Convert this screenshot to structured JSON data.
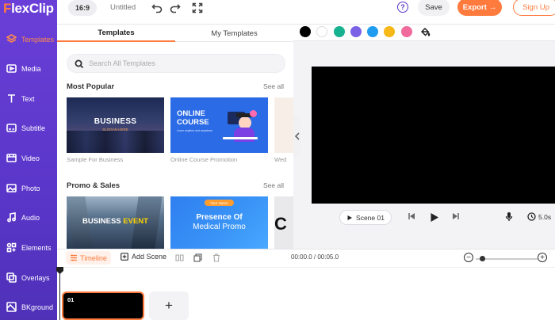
{
  "app": {
    "logo_prefix": "F",
    "logo_rest": "lexClip"
  },
  "topbar": {
    "ratio": "16:9",
    "title": "Untitled",
    "help": "?",
    "save": "Save",
    "export": "Export",
    "export_arrow": "→",
    "signup": "Sign Up"
  },
  "sidebar": {
    "items": [
      {
        "label": "Templates",
        "icon": "templates-icon",
        "active": true
      },
      {
        "label": "Media",
        "icon": "media-icon"
      },
      {
        "label": "Text",
        "icon": "text-icon"
      },
      {
        "label": "Subtitle",
        "icon": "subtitle-icon"
      },
      {
        "label": "Video",
        "icon": "video-icon"
      },
      {
        "label": "Photo",
        "icon": "photo-icon"
      },
      {
        "label": "Audio",
        "icon": "audio-icon"
      },
      {
        "label": "Elements",
        "icon": "elements-icon"
      },
      {
        "label": "Overlays",
        "icon": "overlays-icon"
      },
      {
        "label": "BKground",
        "icon": "background-icon"
      }
    ]
  },
  "panel": {
    "tabs": [
      "Templates",
      "My Templates"
    ],
    "search_placeholder": "Search All Templates",
    "sections": [
      {
        "title": "Most Popular",
        "see_all": "See all",
        "cards": [
          {
            "caption": "Sample For Business",
            "headline": "BUSINESS",
            "sub": "SLOGAN HERE"
          },
          {
            "caption": "Online Course Promotion",
            "headline1": "ONLINE",
            "headline2": "COURSE",
            "sub": "Learn anytime and anywhere"
          },
          {
            "caption": "Wed"
          }
        ]
      },
      {
        "title": "Promo & Sales",
        "see_all": "See all",
        "cards": [
          {
            "headline1": "BUSINESS",
            "headline2": "EVENT"
          },
          {
            "tag": "Your Name",
            "headline1": "Presence Of",
            "headline2": "Medical Promo"
          },
          {
            "headline": "C"
          }
        ]
      }
    ]
  },
  "preview": {
    "colors": [
      "#000000",
      "#ffffff",
      "#17b28f",
      "#7b61e6",
      "#1f9bf0",
      "#f8b817",
      "#f06b9b"
    ],
    "scene_label": "Scene 01",
    "duration": "5.0s"
  },
  "timeline": {
    "label": "Timeline",
    "add_scene": "Add Scene",
    "time": "00:00.0 / 00:05.0",
    "zoom_level": 0.1,
    "clip_label": "01",
    "add_clip": "+"
  }
}
